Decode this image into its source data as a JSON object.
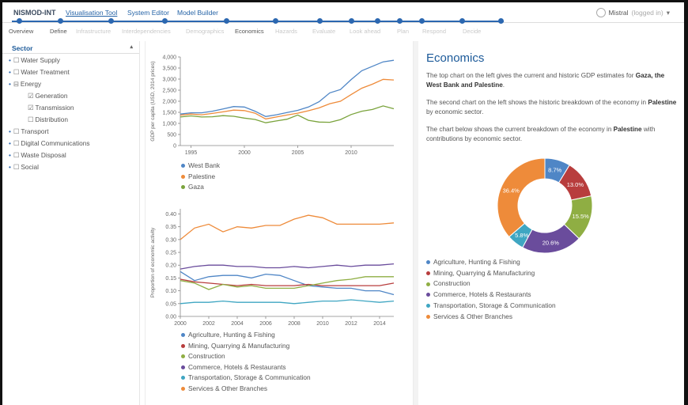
{
  "app": {
    "brand": "NISMOD-INT",
    "nav": [
      "Visualisation Tool",
      "System Editor",
      "Model Builder"
    ],
    "user": "Mistral",
    "user_status": "(logged in)",
    "user_caret": "▾"
  },
  "steps": [
    {
      "label": "Overview",
      "active": true
    },
    {
      "label": "Define",
      "active": true
    },
    {
      "label": "Infrastructure",
      "active": false
    },
    {
      "label": "Interdependencies",
      "active": false
    },
    {
      "label": "Demographics",
      "active": false
    },
    {
      "label": "Economics",
      "active": true
    },
    {
      "label": "Hazards",
      "active": false
    },
    {
      "label": "Evaluate",
      "active": false
    },
    {
      "label": "Look ahead",
      "active": false
    },
    {
      "label": "Plan",
      "active": false
    },
    {
      "label": "Respond",
      "active": false
    },
    {
      "label": "Decide",
      "active": false
    }
  ],
  "sidebar": {
    "title": "Sector",
    "caret": "▴",
    "items": [
      {
        "label": "Water Supply",
        "box": "☐",
        "bullet": "•"
      },
      {
        "label": "Water Treatment",
        "box": "☐",
        "bullet": "•"
      },
      {
        "label": "Energy",
        "box": "⊟",
        "bullet": "•"
      },
      {
        "label": "Generation",
        "box": "☑",
        "bullet": ""
      },
      {
        "label": "Transmission",
        "box": "☑",
        "bullet": ""
      },
      {
        "label": "Distribution",
        "box": "☐",
        "bullet": ""
      },
      {
        "label": "Transport",
        "box": "☐",
        "bullet": "•"
      },
      {
        "label": "Digital Communications",
        "box": "☐",
        "bullet": "•"
      },
      {
        "label": "Waste Disposal",
        "box": "☐",
        "bullet": "•"
      },
      {
        "label": "Social",
        "box": "☐",
        "bullet": "•"
      }
    ]
  },
  "colors": {
    "west_bank": "#4f86c6",
    "palestine": "#ee8b3a",
    "gaza": "#7aa33c",
    "agriculture": "#4f86c6",
    "mining": "#b83d3d",
    "construction": "#8fae43",
    "commerce": "#6a4c9c",
    "transport": "#3fa6c2",
    "services": "#ee8b3a"
  },
  "chart_data": [
    {
      "type": "line",
      "ylabel": "GDP per capita (USD, 2014 prices)",
      "ylim": [
        0,
        4000
      ],
      "yticks": [
        "0",
        "500",
        "1,000",
        "1,500",
        "2,000",
        "2,500",
        "3,000",
        "3,500",
        "4,000"
      ],
      "xticks": [
        "1995",
        "2000",
        "2005",
        "2010"
      ],
      "x": [
        1994,
        1995,
        1996,
        1997,
        1998,
        1999,
        2000,
        2001,
        2002,
        2003,
        2004,
        2005,
        2006,
        2007,
        2008,
        2009,
        2010,
        2011,
        2012,
        2013,
        2014
      ],
      "series": [
        {
          "name": "West Bank",
          "color": "#4f86c6",
          "values": [
            1420,
            1480,
            1480,
            1550,
            1650,
            1760,
            1740,
            1550,
            1310,
            1390,
            1490,
            1590,
            1740,
            1980,
            2380,
            2530,
            2980,
            3380,
            3580,
            3780,
            3850
          ]
        },
        {
          "name": "Palestine",
          "color": "#ee8b3a",
          "values": [
            1370,
            1420,
            1390,
            1450,
            1520,
            1600,
            1580,
            1460,
            1200,
            1290,
            1380,
            1460,
            1570,
            1700,
            1890,
            2000,
            2300,
            2590,
            2770,
            2990,
            2960
          ]
        },
        {
          "name": "Gaza",
          "color": "#7aa33c",
          "values": [
            1290,
            1340,
            1290,
            1300,
            1350,
            1320,
            1240,
            1180,
            1030,
            1110,
            1190,
            1380,
            1140,
            1060,
            1050,
            1170,
            1400,
            1550,
            1630,
            1790,
            1660
          ]
        }
      ]
    },
    {
      "type": "line",
      "ylabel": "Proportion of economic activity",
      "ylim": [
        0,
        0.42
      ],
      "yticks": [
        "0.00",
        "0.05",
        "0.10",
        "0.15",
        "0.20",
        "0.25",
        "0.30",
        "0.35",
        "0.40"
      ],
      "xticks": [
        "2000",
        "2002",
        "2004",
        "2006",
        "2008",
        "2010",
        "2012",
        "2014"
      ],
      "x": [
        2000,
        2001,
        2002,
        2003,
        2004,
        2005,
        2006,
        2007,
        2008,
        2009,
        2010,
        2011,
        2012,
        2013,
        2014,
        2015
      ],
      "series": [
        {
          "name": "Agriculture, Hunting & Fishing",
          "color": "#4f86c6",
          "values": [
            0.175,
            0.14,
            0.155,
            0.16,
            0.16,
            0.15,
            0.165,
            0.16,
            0.14,
            0.12,
            0.115,
            0.11,
            0.11,
            0.1,
            0.1,
            0.085
          ]
        },
        {
          "name": "Mining, Quarrying & Manufacturing",
          "color": "#b83d3d",
          "values": [
            0.145,
            0.135,
            0.13,
            0.125,
            0.12,
            0.125,
            0.12,
            0.12,
            0.12,
            0.125,
            0.12,
            0.12,
            0.12,
            0.12,
            0.12,
            0.13
          ]
        },
        {
          "name": "Construction",
          "color": "#8fae43",
          "values": [
            0.14,
            0.13,
            0.105,
            0.125,
            0.115,
            0.12,
            0.11,
            0.11,
            0.11,
            0.12,
            0.13,
            0.14,
            0.145,
            0.155,
            0.155,
            0.155
          ]
        },
        {
          "name": "Commerce, Hotels & Restaurants",
          "color": "#6a4c9c",
          "values": [
            0.185,
            0.195,
            0.2,
            0.2,
            0.195,
            0.195,
            0.19,
            0.19,
            0.195,
            0.19,
            0.195,
            0.2,
            0.195,
            0.2,
            0.2,
            0.205
          ]
        },
        {
          "name": "Transportation, Storage & Communication",
          "color": "#3fa6c2",
          "values": [
            0.05,
            0.055,
            0.055,
            0.06,
            0.055,
            0.055,
            0.055,
            0.055,
            0.05,
            0.055,
            0.06,
            0.06,
            0.065,
            0.06,
            0.055,
            0.06
          ]
        },
        {
          "name": "Services & Other Branches",
          "color": "#ee8b3a",
          "values": [
            0.3,
            0.345,
            0.36,
            0.33,
            0.35,
            0.345,
            0.355,
            0.355,
            0.38,
            0.395,
            0.385,
            0.36,
            0.36,
            0.36,
            0.36,
            0.365
          ]
        }
      ]
    },
    {
      "type": "pie",
      "series": [
        {
          "name": "Agriculture, Hunting & Fishing",
          "value": 8.7,
          "label": "8.7%",
          "color": "#4f86c6"
        },
        {
          "name": "Mining, Quarrying & Manufacturing",
          "value": 13.0,
          "label": "13.0%",
          "color": "#b83d3d"
        },
        {
          "name": "Construction",
          "value": 15.5,
          "label": "15.5%",
          "color": "#8fae43"
        },
        {
          "name": "Commerce, Hotels & Restaurants",
          "value": 20.6,
          "label": "20.6%",
          "color": "#6a4c9c"
        },
        {
          "name": "Transportation, Storage & Communication",
          "value": 5.8,
          "label": "5.8%",
          "color": "#3fa6c2"
        },
        {
          "name": "Services & Other Branches",
          "value": 36.4,
          "label": "36.4%",
          "color": "#ee8b3a"
        }
      ]
    }
  ],
  "right": {
    "title": "Economics",
    "p1": [
      "The top chart on the left gives the current and historic GDP estimates for ",
      "Gaza, the West Bank and Palestine",
      "."
    ],
    "p2": [
      "The second chart on the left shows the historic breakdown of the economy in ",
      "Palestine",
      " by economic sector."
    ],
    "p3": [
      "The chart below shows the current breakdown of the economy in ",
      "Palestine",
      " with contributions by economic sector."
    ]
  }
}
